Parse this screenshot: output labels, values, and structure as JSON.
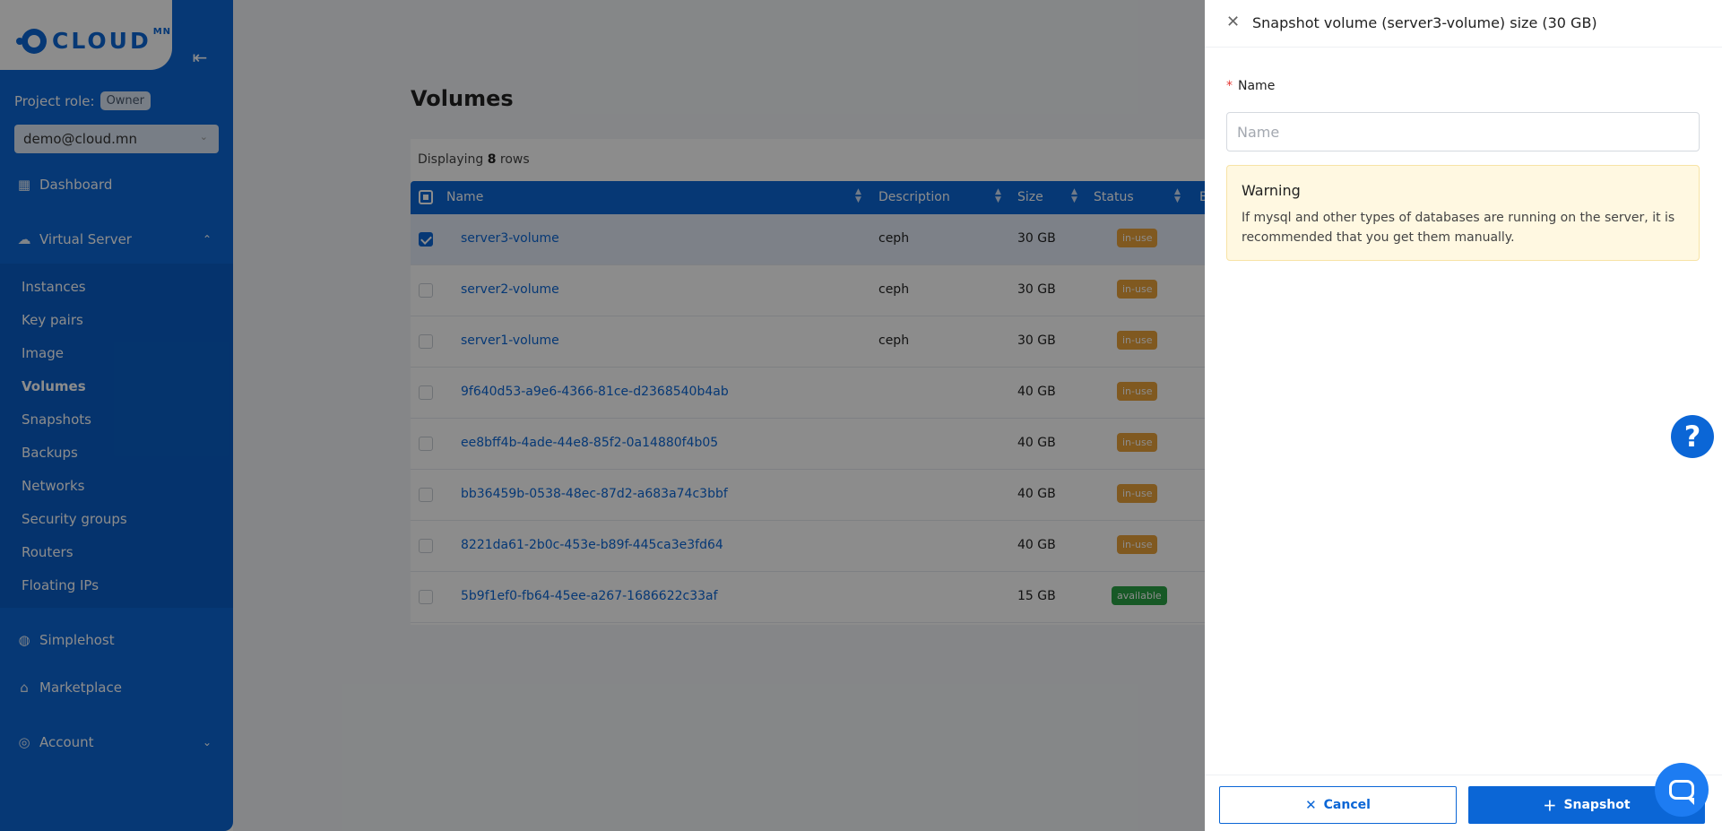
{
  "brand": {
    "name": "CLOUD",
    "suffix": "MN"
  },
  "sidebar": {
    "collapse_icon": "collapse-left-icon",
    "role_label": "Project role:",
    "role_badge": "Owner",
    "project": "demo@cloud.mn",
    "nav": [
      {
        "label": "Dashboard",
        "icon": "dashboard-icon"
      },
      {
        "label": "Virtual Server",
        "icon": "cloud-icon"
      },
      {
        "label": "Simplehost",
        "icon": "globe-icon"
      },
      {
        "label": "Marketplace",
        "icon": "bag-icon"
      },
      {
        "label": "Account",
        "icon": "user-icon"
      }
    ],
    "submenu": [
      "Instances",
      "Key pairs",
      "Image",
      "Volumes",
      "Snapshots",
      "Backups",
      "Networks",
      "Security groups",
      "Routers",
      "Floating IPs"
    ],
    "active_item": "Volumes"
  },
  "main": {
    "title": "Volumes",
    "displaying_prefix": "Displaying",
    "displaying_count": "8",
    "displaying_suffix": "rows",
    "columns": [
      "Name",
      "Description",
      "Size",
      "Status",
      "B"
    ],
    "rows": [
      {
        "name": "server3-volume",
        "description": "ceph",
        "size": "30 GB",
        "status": "in-use",
        "selected": true
      },
      {
        "name": "server2-volume",
        "description": "ceph",
        "size": "30 GB",
        "status": "in-use",
        "selected": false
      },
      {
        "name": "server1-volume",
        "description": "ceph",
        "size": "30 GB",
        "status": "in-use",
        "selected": false
      },
      {
        "name": "9f640d53-a9e6-4366-81ce-d2368540b4ab",
        "description": "",
        "size": "40 GB",
        "status": "in-use",
        "selected": false
      },
      {
        "name": "ee8bff4b-4ade-44e8-85f2-0a14880f4b05",
        "description": "",
        "size": "40 GB",
        "status": "in-use",
        "selected": false
      },
      {
        "name": "bb36459b-0538-48ec-87d2-a683a74c3bbf",
        "description": "",
        "size": "40 GB",
        "status": "in-use",
        "selected": false
      },
      {
        "name": "8221da61-2b0c-453e-b89f-445ca3e3fd64",
        "description": "",
        "size": "40 GB",
        "status": "in-use",
        "selected": false
      },
      {
        "name": "5b9f1ef0-fb64-45ee-a267-1686622c33af",
        "description": "",
        "size": "15 GB",
        "status": "available",
        "selected": false
      }
    ]
  },
  "drawer": {
    "title": "Snapshot volume (server3-volume) size (30 GB)",
    "name_label": "Name",
    "name_placeholder": "Name",
    "name_value": "",
    "warning_title": "Warning",
    "warning_text": "If mysql and other types of databases are running on the server, it is recommended that you get them manually.",
    "cancel_label": "Cancel",
    "submit_label": "Snapshot"
  },
  "colors": {
    "primary": "#0b66d6",
    "in_use": "#e9a23b",
    "available": "#2aa345",
    "warning_bg": "#fff8e1"
  }
}
